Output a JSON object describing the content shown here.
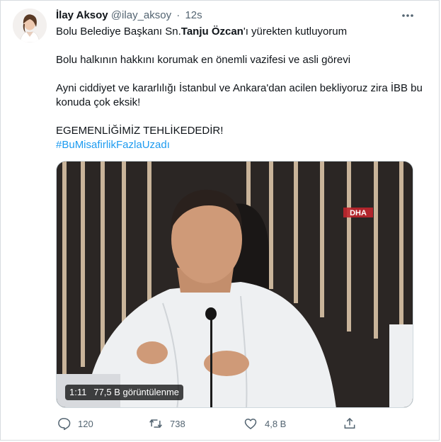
{
  "tweet": {
    "author_name": "İlay Aksoy",
    "handle": "@ilay_aksoy",
    "separator": "·",
    "time": "12s",
    "text": {
      "line1_prefix": "Bolu Belediye Başkanı Sn.",
      "line1_bold": "Tanju Özcan",
      "line1_suffix": "'ı yürekten kutluyorum",
      "line2": "Bolu halkının hakkını korumak en önemli vazifesi ve asli görevi",
      "line3": "Ayni ciddiyet ve kararlılığı İstanbul ve Ankara'dan acilen bekliyoruz zira İBB bu konuda çok eksik!",
      "line4": "EGEMENLİĞİMİZ TEHLİKEDEDİR!",
      "hashtag": "#BuMisafirlikFazlaUzadı"
    },
    "video": {
      "duration": "1:11",
      "views": "77,5 B görüntülenme",
      "watermark": "DHA"
    },
    "actions": {
      "replies": "120",
      "retweets": "738",
      "likes": "4,8 B"
    },
    "icons": [
      "avatar",
      "more-icon",
      "reply-icon",
      "retweet-icon",
      "like-icon",
      "share-icon"
    ],
    "colors": {
      "link": "#1d9bf0",
      "muted": "#536471",
      "text": "#0f1419"
    }
  }
}
